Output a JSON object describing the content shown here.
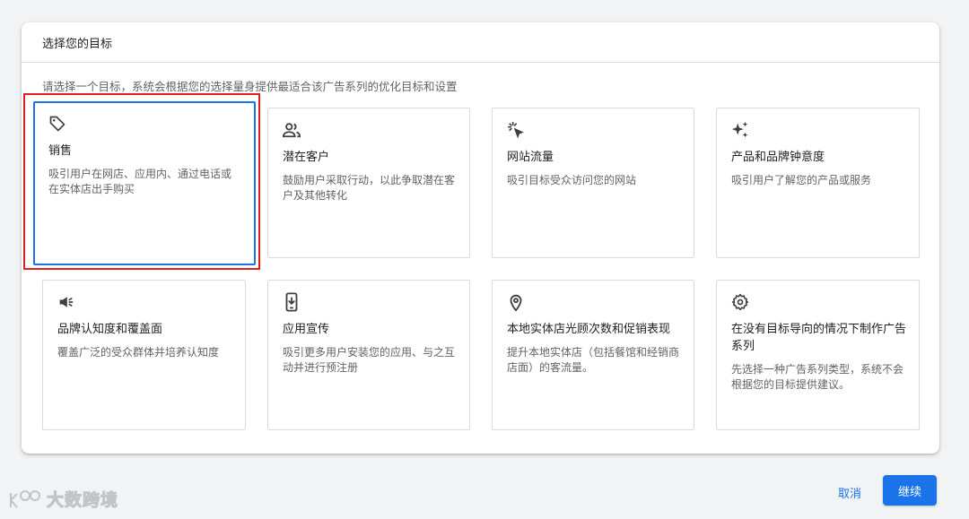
{
  "dialog": {
    "title": "选择您的目标",
    "description": "请选择一个目标，系统会根据您的选择量身提供最适合该广告系列的优化目标和设置"
  },
  "goals": [
    {
      "title": "销售",
      "text": "吸引用户在网店、应用内、通过电话或在实体店出手购买",
      "icon": "tag-icon",
      "selected": true
    },
    {
      "title": "潜在客户",
      "text": "鼓励用户采取行动，以此争取潜在客户及其他转化",
      "icon": "people-icon",
      "selected": false
    },
    {
      "title": "网站流量",
      "text": "吸引目标受众访问您的网站",
      "icon": "cursor-click-icon",
      "selected": false
    },
    {
      "title": "产品和品牌钟意度",
      "text": "吸引用户了解您的产品或服务",
      "icon": "sparkle-icon",
      "selected": false
    },
    {
      "title": "品牌认知度和覆盖面",
      "text": "覆盖广泛的受众群体并培养认知度",
      "icon": "megaphone-icon",
      "selected": false
    },
    {
      "title": "应用宣传",
      "text": "吸引更多用户安装您的应用、与之互动并进行预注册",
      "icon": "phone-download-icon",
      "selected": false
    },
    {
      "title": "本地实体店光顾次数和促销表现",
      "text": "提升本地实体店（包括餐馆和经销商店面）的客流量。",
      "icon": "location-pin-icon",
      "selected": false
    },
    {
      "title": "在没有目标导向的情况下制作广告系列",
      "text": "先选择一种广告系列类型，系统不会根据您的目标提供建议。",
      "icon": "gear-icon",
      "selected": false
    }
  ],
  "footer": {
    "cancel_label": "取消",
    "continue_label": "继续"
  },
  "watermark": {
    "text": "大数跨境"
  },
  "colors": {
    "accent": "#1a73e8",
    "highlight": "#e0201b"
  }
}
